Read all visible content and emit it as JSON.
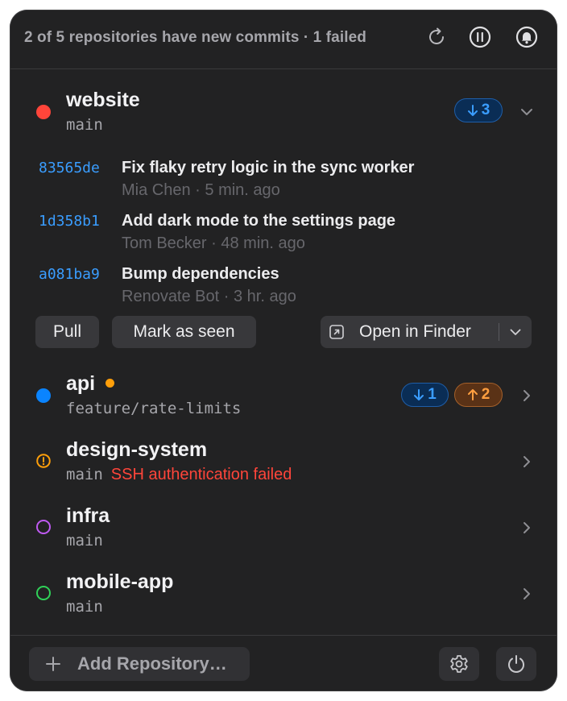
{
  "header": {
    "summary": "2 of 5 repositories have new commits · 1 failed",
    "icons": [
      "refresh-icon",
      "pause-icon",
      "bell-icon"
    ]
  },
  "repos": [
    {
      "name": "website",
      "branch": "main",
      "status_color": "#ff453a",
      "status": "new-commits",
      "behind": "3",
      "expanded": true,
      "commits": [
        {
          "sha": "83565de",
          "message": "Fix flaky retry logic in the sync worker",
          "author": "Mia Chen",
          "time": "5 min. ago"
        },
        {
          "sha": "1d358b1",
          "message": "Add dark mode to the settings page",
          "author": "Tom Becker",
          "time": "48 min. ago"
        },
        {
          "sha": "a081ba9",
          "message": "Bump dependencies",
          "author": "Renovate Bot",
          "time": "3 hr. ago"
        }
      ],
      "actions": {
        "pull": "Pull",
        "mark_seen": "Mark as seen",
        "open_finder": "Open in Finder"
      }
    },
    {
      "name": "api",
      "branch": "feature/rate-limits",
      "status_color": "#0a84ff",
      "modified_color": "#ff9f0a",
      "behind": "1",
      "ahead": "2"
    },
    {
      "name": "design-system",
      "branch": "main",
      "status_color": "#ff9f0a",
      "error": "SSH authentication failed"
    },
    {
      "name": "infra",
      "branch": "main",
      "status_color": "#bf5af2"
    },
    {
      "name": "mobile-app",
      "branch": "main",
      "status_color": "#30d158"
    }
  ],
  "footer": {
    "add_repository": "Add Repository…",
    "icons": [
      "plus-icon",
      "gear-icon",
      "power-icon"
    ]
  },
  "colors": {
    "panel_bg": "#222223",
    "accent_blue": "#3a9dff",
    "accent_orange": "#ff9f40",
    "error_red": "#ff453a"
  }
}
